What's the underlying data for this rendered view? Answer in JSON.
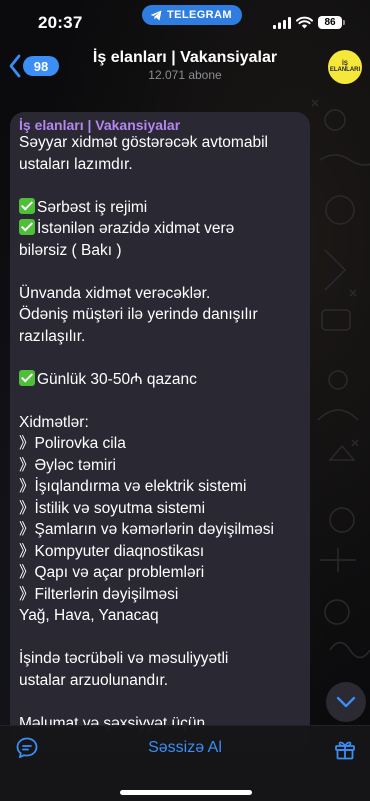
{
  "status_bar": {
    "time": "20:37",
    "app_pill": "TELEGRAM",
    "battery": "86"
  },
  "header": {
    "back_count": "98",
    "title": "İş elanları | Vakansiyalar",
    "subtitle": "12.071 abone",
    "avatar_text": "İŞ ELANLARI"
  },
  "message": {
    "author": "İş elanları | Vakansiyalar",
    "lines": [
      {
        "text": "Səyyar xidmət göstərəcək avtomabil",
        "check": false
      },
      {
        "text": "ustaları lazımdır.",
        "check": false
      },
      {
        "text": "",
        "check": false
      },
      {
        "text": "Sərbəst iş rejimi",
        "check": true
      },
      {
        "text": "İstənilən ərazidə xidmət verə",
        "check": true
      },
      {
        "text": "bilərsiz ( Bakı )",
        "check": false
      },
      {
        "text": "",
        "check": false
      },
      {
        "text": "Ünvanda xidmət verəcəklər.",
        "check": false
      },
      {
        "text": "Ödəniş müştəri ilə yerində danışılır",
        "check": false
      },
      {
        "text": "razılaşılır.",
        "check": false
      },
      {
        "text": "",
        "check": false
      },
      {
        "text": "Günlük 30-50₼ qazanc",
        "check": true
      },
      {
        "text": "",
        "check": false
      },
      {
        "text": "Xidmətlər:",
        "check": false
      },
      {
        "text": "》Polirovka cila",
        "check": false
      },
      {
        "text": "》Əyləc təmiri",
        "check": false
      },
      {
        "text": "》İşıqlandırma və elektrik sistemi",
        "check": false
      },
      {
        "text": "》İstilik və soyutma sistemi",
        "check": false
      },
      {
        "text": "》Şamların və kəmərlərin dəyişilməsi",
        "check": false
      },
      {
        "text": "》Kompyuter diaqnostikası",
        "check": false
      },
      {
        "text": "》Qapı və açar problemləri",
        "check": false
      },
      {
        "text": "》Filterlərin dəyişilməsi",
        "check": false
      },
      {
        "text": "Yağ, Hava, Yanacaq",
        "check": false
      },
      {
        "text": "",
        "check": false
      },
      {
        "text": "İşində təcrübəli və məsuliyyətli",
        "check": false
      },
      {
        "text": "ustalar arzuolunandır.",
        "check": false
      },
      {
        "text": "",
        "check": false
      },
      {
        "text": "Məlumat və şəxsiyyət üçün",
        "check": false
      }
    ]
  },
  "bottom_bar": {
    "mute_label": "Səssizə Al"
  },
  "icons": {
    "back": "chevron-left-icon",
    "comments": "comment-icon",
    "gift": "gift-icon",
    "scroll": "chevron-down-icon"
  },
  "colors": {
    "accent": "#3a8ef5",
    "author": "#b386f0",
    "bubble": "#2a2833",
    "check": "#4fbf3a"
  }
}
